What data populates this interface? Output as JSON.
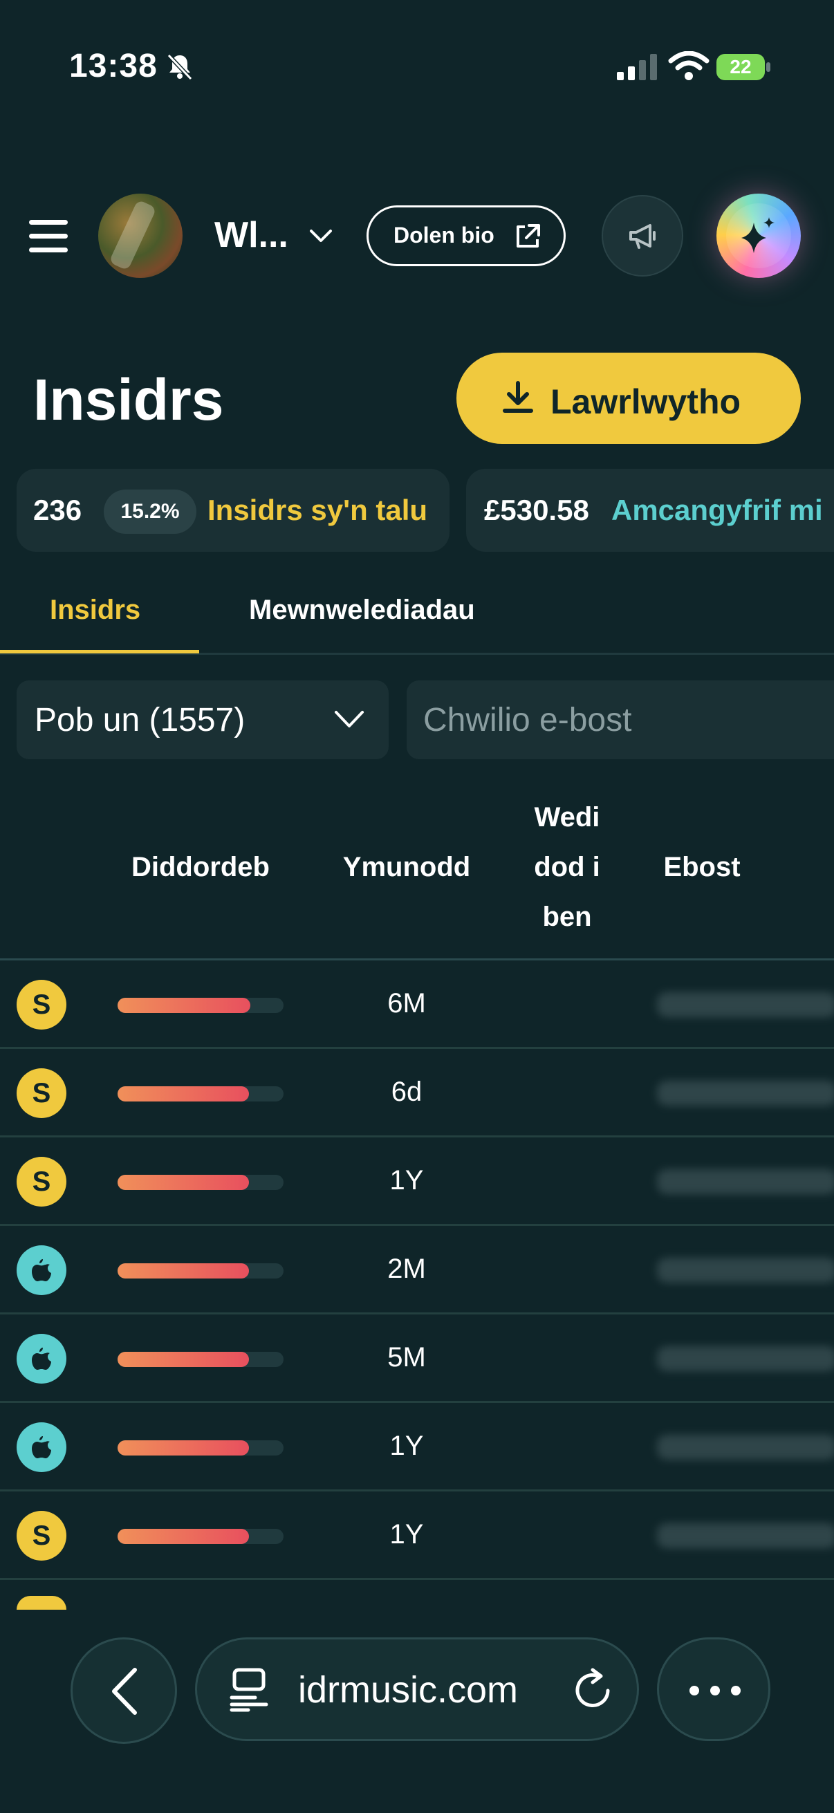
{
  "status_bar": {
    "time": "13:38",
    "battery": "22"
  },
  "header": {
    "account_name": "Wl...",
    "bio_link_label": "Dolen bio"
  },
  "page": {
    "title": "Insidrs",
    "download_label": "Lawrlwytho"
  },
  "stats": {
    "paying_count": "236",
    "paying_percent": "15.2%",
    "paying_label": "Insidrs sy'n talu",
    "estimate_amount": "£530.58",
    "estimate_label": "Amcangyfrif mi"
  },
  "tabs": [
    {
      "label": "Insidrs",
      "active": true
    },
    {
      "label": "Mewnwelediadau",
      "active": false
    }
  ],
  "filter": {
    "selected": "Pob un (1557)"
  },
  "search": {
    "placeholder": "Chwilio e-bost"
  },
  "table": {
    "columns": {
      "interest": "Diddordeb",
      "joined": "Ymunodd",
      "churned": "Wedi dod i ben",
      "email": "Ebost"
    },
    "rows": [
      {
        "platform": "S",
        "interest": 0.8,
        "joined": "6M"
      },
      {
        "platform": "S",
        "interest": 0.79,
        "joined": "6d"
      },
      {
        "platform": "S",
        "interest": 0.79,
        "joined": "1Y"
      },
      {
        "platform": "apple-icon",
        "interest": 0.79,
        "joined": "2M"
      },
      {
        "platform": "apple-icon",
        "interest": 0.79,
        "joined": "5M"
      },
      {
        "platform": "apple-icon",
        "interest": 0.79,
        "joined": "1Y"
      },
      {
        "platform": "S",
        "interest": 0.79,
        "joined": "1Y"
      }
    ]
  },
  "browser": {
    "url": "idrmusic.com"
  },
  "colors": {
    "background": "#0f2529",
    "accent_yellow": "#f0c93e",
    "accent_teal": "#5ccfcf",
    "card": "#1a3034"
  }
}
